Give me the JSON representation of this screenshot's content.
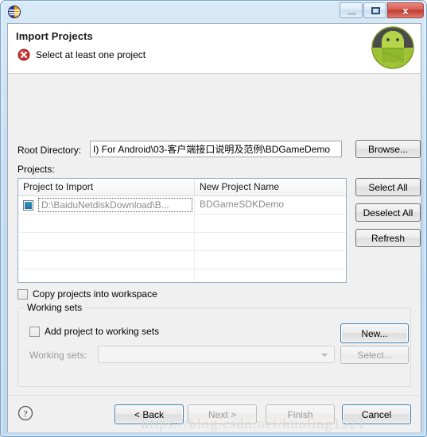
{
  "window": {
    "app_icon": "eclipse-globe-icon",
    "buttons": {
      "minimize": "minimize-icon",
      "restore": "restore-icon",
      "close_label": "x"
    }
  },
  "header": {
    "title": "Import Projects",
    "message": "Select at least one project",
    "error_icon": "error-circle-icon",
    "logo": "android-robot-logo"
  },
  "form": {
    "root_directory_label": "Root Directory:",
    "root_directory_value": "I) For Android\\03-客户端接口说明及范例\\BDGameDemo",
    "browse_label": "Browse...",
    "projects_label": "Projects:"
  },
  "table": {
    "columns": [
      "Project to Import",
      "New Project Name"
    ],
    "rows": [
      {
        "checked": true,
        "project_to_import": "D:\\BaiduNetdiskDownload\\B...",
        "new_project_name": "BDGameSDKDemo"
      },
      {
        "checked": false,
        "project_to_import": "",
        "new_project_name": ""
      },
      {
        "checked": false,
        "project_to_import": "",
        "new_project_name": ""
      },
      {
        "checked": false,
        "project_to_import": "",
        "new_project_name": ""
      },
      {
        "checked": false,
        "project_to_import": "",
        "new_project_name": ""
      }
    ],
    "side_buttons": {
      "select_all": "Select All",
      "deselect_all": "Deselect All",
      "refresh": "Refresh"
    }
  },
  "options": {
    "copy_projects_label": "Copy projects into workspace",
    "copy_projects_checked": false
  },
  "working_sets": {
    "group_title": "Working sets",
    "add_project_label": "Add project to working sets",
    "add_project_checked": false,
    "working_sets_label": "Working sets:",
    "combo_value": "",
    "new_label": "New...",
    "select_label": "Select..."
  },
  "footer": {
    "help_icon": "help-question-icon",
    "back_label": "< Back",
    "next_label": "Next >",
    "finish_label": "Finish",
    "cancel_label": "Cancel"
  },
  "watermark": "https://blog.csdn.net/huoling1521",
  "colors": {
    "accent_blue": "#3c7fb1",
    "error_red": "#cc3333",
    "android_green": "#a4c639",
    "close_red": "#bf3b31"
  }
}
